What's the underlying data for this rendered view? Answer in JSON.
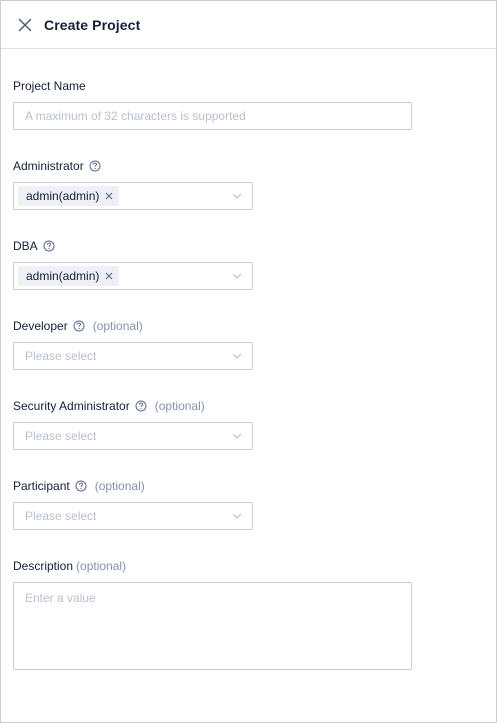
{
  "header": {
    "title": "Create Project"
  },
  "form": {
    "project_name": {
      "label": "Project Name",
      "placeholder": "A maximum of 32 characters is supported"
    },
    "administrator": {
      "label": "Administrator",
      "selected_tag": "admin(admin)"
    },
    "dba": {
      "label": "DBA",
      "selected_tag": "admin(admin)"
    },
    "developer": {
      "label": "Developer",
      "optional": "(optional)",
      "placeholder": "Please select"
    },
    "security_administrator": {
      "label": "Security Administrator",
      "optional": "(optional)",
      "placeholder": "Please select"
    },
    "participant": {
      "label": "Participant",
      "optional": "(optional)",
      "placeholder": "Please select"
    },
    "description": {
      "label": "Description",
      "optional": "(optional)",
      "placeholder": "Enter a value"
    }
  },
  "icons": {
    "close": "close-icon",
    "help": "question-circle-icon",
    "chevron": "chevron-down-icon",
    "tag_remove": "tag-remove-icon"
  },
  "colors": {
    "text": "#132039",
    "muted": "#8592ad",
    "placeholder": "#b8c0cf",
    "border": "#c7ccd6",
    "tag_bg": "#edf0f4"
  }
}
